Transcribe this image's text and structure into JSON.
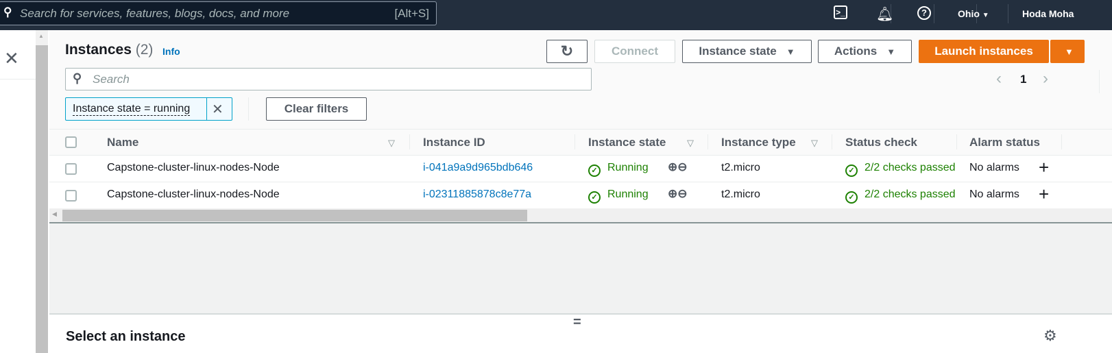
{
  "topnav": {
    "search_placeholder": "Search for services, features, blogs, docs, and more",
    "search_shortcut": "[Alt+S]",
    "region": "Ohio",
    "user": "Hoda Moha"
  },
  "header": {
    "title": "Instances",
    "count": "(2)",
    "info": "Info"
  },
  "toolbar": {
    "connect": "Connect",
    "instance_state": "Instance state",
    "actions": "Actions",
    "launch": "Launch instances"
  },
  "search": {
    "placeholder": "Search"
  },
  "filter": {
    "token": "Instance state = running",
    "clear": "Clear filters"
  },
  "pagination": {
    "page": "1"
  },
  "table": {
    "columns": [
      "Name",
      "Instance ID",
      "Instance state",
      "Instance type",
      "Status check",
      "Alarm status"
    ],
    "rows": [
      {
        "name": "Capstone-cluster-linux-nodes-Node",
        "id": "i-041a9a9d965bdb646",
        "state": "Running",
        "type": "t2.micro",
        "status": "2/2 checks passed",
        "alarm": "No alarms"
      },
      {
        "name": "Capstone-cluster-linux-nodes-Node",
        "id": "i-02311885878c8e77a",
        "state": "Running",
        "type": "t2.micro",
        "status": "2/2 checks passed",
        "alarm": "No alarms"
      }
    ]
  },
  "details": {
    "title": "Select an instance"
  },
  "colors": {
    "nav": "#232f3e",
    "primary": "#ec7211",
    "link": "#0073bb",
    "success": "#1d8102"
  }
}
